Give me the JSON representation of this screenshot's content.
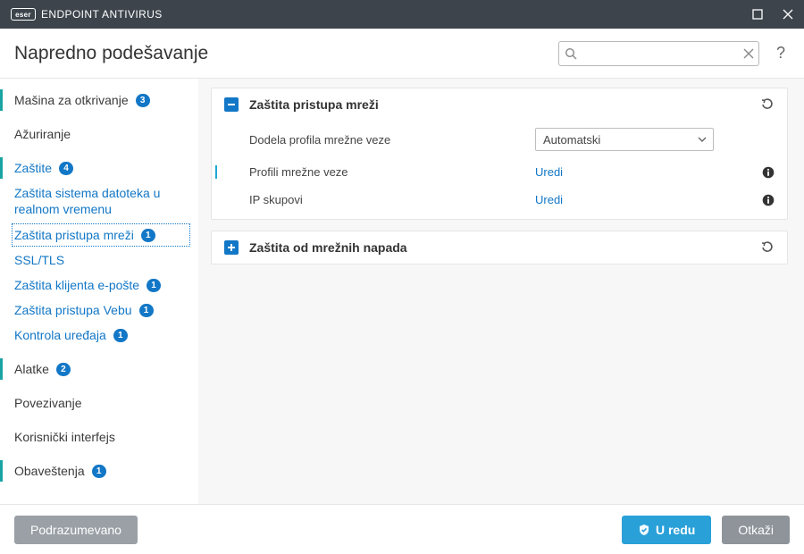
{
  "app": {
    "brand_logo_text": "eser",
    "brand_name": "ENDPOINT ANTIVIRUS"
  },
  "header": {
    "title": "Napredno podešavanje",
    "search_placeholder": ""
  },
  "sidebar": {
    "items": [
      {
        "label": "Mašina za otkrivanje",
        "badge": "3"
      },
      {
        "label": "Ažuriranje"
      },
      {
        "label": "Zaštite",
        "badge": "4"
      },
      {
        "label": "Zaštita sistema datoteka u realnom vremenu"
      },
      {
        "label": "Zaštita pristupa mreži",
        "badge": "1"
      },
      {
        "label": "SSL/TLS"
      },
      {
        "label": "Zaštita klijenta e-pošte",
        "badge": "1"
      },
      {
        "label": "Zaštita pristupa Vebu",
        "badge": "1"
      },
      {
        "label": "Kontrola uređaja",
        "badge": "1"
      },
      {
        "label": "Alatke",
        "badge": "2"
      },
      {
        "label": "Povezivanje"
      },
      {
        "label": "Korisnički interfejs"
      },
      {
        "label": "Obaveštenja",
        "badge": "1"
      }
    ]
  },
  "panels": {
    "network_access": {
      "title": "Zaštita pristupa mreži",
      "rows": {
        "profile_assign": {
          "label": "Dodela profila mrežne veze",
          "value": "Automatski"
        },
        "profiles": {
          "label": "Profili mrežne veze",
          "action": "Uredi"
        },
        "ip_sets": {
          "label": "IP skupovi",
          "action": "Uredi"
        }
      }
    },
    "network_attack": {
      "title": "Zaštita od mrežnih napada"
    }
  },
  "footer": {
    "default": "Podrazumevano",
    "ok": "U redu",
    "cancel": "Otkaži"
  }
}
